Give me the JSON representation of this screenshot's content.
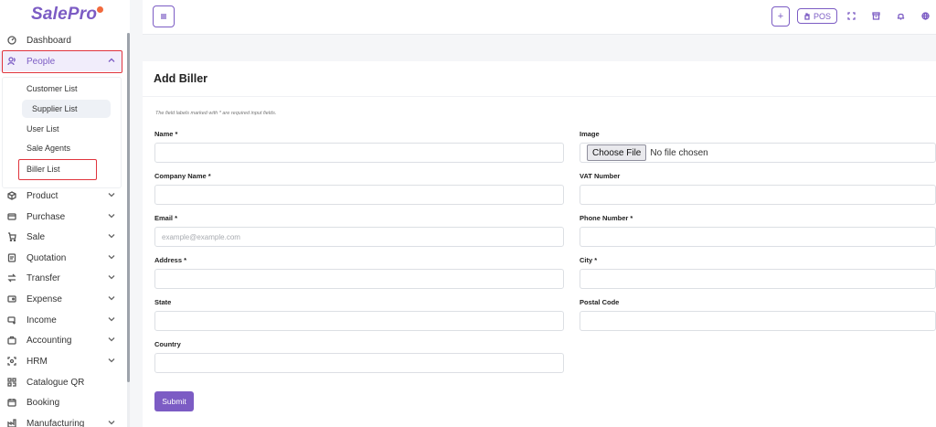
{
  "brand": {
    "logo_text": "SalePro"
  },
  "sidebar": {
    "items": [
      {
        "label": "Dashboard",
        "icon": "dashboard-icon"
      },
      {
        "label": "People",
        "icon": "people-icon"
      },
      {
        "label": "Product",
        "icon": "product-icon"
      },
      {
        "label": "Purchase",
        "icon": "purchase-icon"
      },
      {
        "label": "Sale",
        "icon": "sale-icon"
      },
      {
        "label": "Quotation",
        "icon": "quotation-icon"
      },
      {
        "label": "Transfer",
        "icon": "transfer-icon"
      },
      {
        "label": "Expense",
        "icon": "expense-icon"
      },
      {
        "label": "Income",
        "icon": "income-icon"
      },
      {
        "label": "Accounting",
        "icon": "accounting-icon"
      },
      {
        "label": "HRM",
        "icon": "hrm-icon"
      },
      {
        "label": "Catalogue QR",
        "icon": "qr-icon"
      },
      {
        "label": "Booking",
        "icon": "booking-icon"
      },
      {
        "label": "Manufacturing",
        "icon": "manufacturing-icon"
      }
    ],
    "people_submenu": [
      {
        "label": "Customer List"
      },
      {
        "label": "Supplier List"
      },
      {
        "label": "User List"
      },
      {
        "label": "Sale Agents"
      },
      {
        "label": "Biller List"
      }
    ]
  },
  "topbar": {
    "plus_label": "+",
    "pos_label": "POS"
  },
  "form": {
    "title": "Add Biller",
    "required_note": "The field labels marked with * are required input fields.",
    "name_label": "Name *",
    "image_label": "Image",
    "file_button": "Choose File",
    "file_status": "No file chosen",
    "company_label": "Company Name *",
    "vat_label": "VAT Number",
    "email_label": "Email *",
    "email_placeholder": "example@example.com",
    "phone_label": "Phone Number *",
    "address_label": "Address *",
    "city_label": "City *",
    "state_label": "State",
    "postal_label": "Postal Code",
    "country_label": "Country",
    "submit_label": "Submit"
  },
  "colors": {
    "accent": "#7c5cc4",
    "highlight_red": "#e0343d",
    "logo_dot": "#f26a3d"
  }
}
